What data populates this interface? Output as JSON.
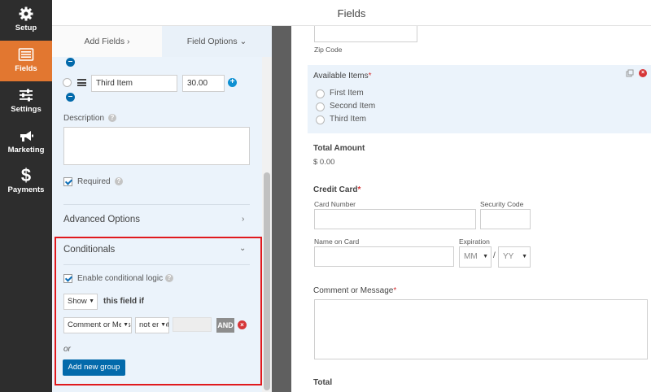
{
  "nav": {
    "items": [
      {
        "label": "Setup",
        "icon": "gear-icon"
      },
      {
        "label": "Fields",
        "icon": "fields-icon"
      },
      {
        "label": "Settings",
        "icon": "sliders-icon"
      },
      {
        "label": "Marketing",
        "icon": "megaphone-icon"
      },
      {
        "label": "Payments",
        "icon": "dollar-icon",
        "glyph": "$"
      }
    ],
    "active": "Fields",
    "colors": {
      "background": "#2d2d2d",
      "active": "#e27730"
    }
  },
  "header": {
    "title": "Fields"
  },
  "panel": {
    "tabs": {
      "add_fields": "Add Fields ›",
      "field_options": "Field Options ⌄"
    },
    "choice": {
      "label": "Third Item",
      "value": "30.00"
    },
    "description_label": "Description",
    "required_label": "Required",
    "advanced_options": "Advanced Options",
    "conditionals": {
      "title": "Conditionals",
      "enable_label": "Enable conditional logic",
      "action_select": "Show",
      "action_suffix": "this field if",
      "field_select": "Comment or Message",
      "operator_select": "not empty",
      "and_button": "AND",
      "or_label": "or",
      "add_group_button": "Add new group"
    }
  },
  "preview": {
    "zip_code_label": "Zip Code",
    "available_items": {
      "label": "Available Items",
      "options": [
        "First Item",
        "Second Item",
        "Third Item"
      ]
    },
    "total_amount": {
      "label": "Total Amount",
      "value": "$ 0.00"
    },
    "credit_card": {
      "label": "Credit Card",
      "card_number": "Card Number",
      "security_code": "Security Code",
      "name_on_card": "Name on Card",
      "expiration": "Expiration",
      "month_placeholder": "MM",
      "year_placeholder": "YY",
      "separator": "/"
    },
    "comment": {
      "label": "Comment or Message"
    },
    "total": {
      "label": "Total"
    },
    "required_mark": "*"
  },
  "colors": {
    "accent": "#e27730",
    "primary": "#036aab",
    "highlight_border": "#e0191e",
    "panel_bg": "#ebf3fb"
  }
}
